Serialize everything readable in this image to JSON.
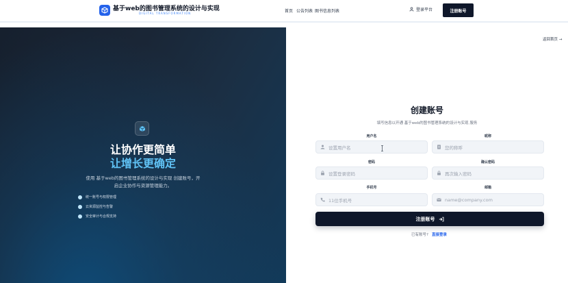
{
  "header": {
    "title": "基于web的图书管理系统的设计与实现",
    "subtitle": "DIGITAL TRANSFORMATION",
    "nav": [
      "首页",
      "公告列表",
      "图书信息列表"
    ],
    "login_label": "登录平台",
    "register_label": "注册账号",
    "logo_icon": "cube-icon",
    "user_icon": "user-icon"
  },
  "hero": {
    "icon": "cube-icon",
    "headline_1": "让协作更简单",
    "headline_2": "让增长更确定",
    "desc_1": "使用 基于web的图书管理系统的设计与实现 创建账号，开",
    "desc_2": "启企业协作与资源管理能力。",
    "features": [
      "统一账号与权限管理",
      "云资源监控与告警",
      "安全审计与合规支持"
    ],
    "accent_color": "#60c2f5"
  },
  "back_label": "返回首页",
  "form": {
    "title": "创建账号",
    "subtitle": "填写信息以开通 基于web的图书管理系统的设计与实现 服务",
    "fields": {
      "username": {
        "label": "用户名",
        "placeholder": "设置用户名",
        "icon": "user-icon"
      },
      "nickname": {
        "label": "昵称",
        "placeholder": "您的称呼",
        "icon": "id-card-icon"
      },
      "password": {
        "label": "密码",
        "placeholder": "设置登录密码",
        "icon": "lock-icon"
      },
      "confirm": {
        "label": "确认密码",
        "placeholder": "再次输入密码",
        "icon": "lock-icon"
      },
      "phone": {
        "label": "手机号",
        "placeholder": "11位手机号",
        "icon": "phone-icon"
      },
      "email": {
        "label": "邮箱",
        "placeholder": "name@company.com",
        "icon": "mail-icon"
      }
    },
    "submit_label": "注册账号",
    "have_account": "已有账号?",
    "login_direct": "直接登录"
  },
  "colors": {
    "primary_dark": "#0f172a",
    "link_blue": "#2563eb",
    "logo_blue": "#2563eb"
  }
}
